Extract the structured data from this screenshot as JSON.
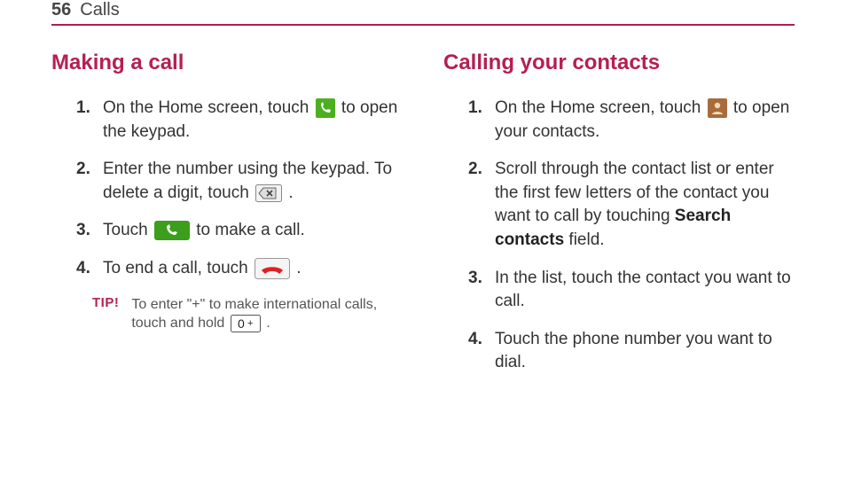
{
  "header": {
    "page_number": "56",
    "section": "Calls"
  },
  "left": {
    "title": "Making a call",
    "steps": [
      {
        "pre": "On the Home screen, touch ",
        "icon": "phone-app-icon",
        "post": " to open the keypad."
      },
      {
        "pre": "Enter the number using the keypad. To delete a digit, touch ",
        "icon": "backspace-icon",
        "post": "."
      },
      {
        "pre": "Touch ",
        "icon": "call-button-icon",
        "post": " to make a call."
      },
      {
        "pre": "To end a call, touch ",
        "icon": "end-call-icon",
        "post": "."
      }
    ],
    "tip": {
      "label": "TIP!",
      "pre": "To enter \"+\" to make international calls, touch and hold ",
      "icon": "zero-plus-key-icon",
      "post": "."
    }
  },
  "right": {
    "title": "Calling your contacts",
    "steps": [
      {
        "pre": "On the Home screen, touch ",
        "icon": "contacts-app-icon",
        "post": " to open your contacts."
      },
      {
        "pre": "Scroll through the contact list or enter the first few letters of the contact you want to call by touching ",
        "bold": "Search contacts",
        "post": " field."
      },
      {
        "pre": "In the list, touch the contact you want to call."
      },
      {
        "pre": "Touch the phone number you want to dial."
      }
    ]
  }
}
